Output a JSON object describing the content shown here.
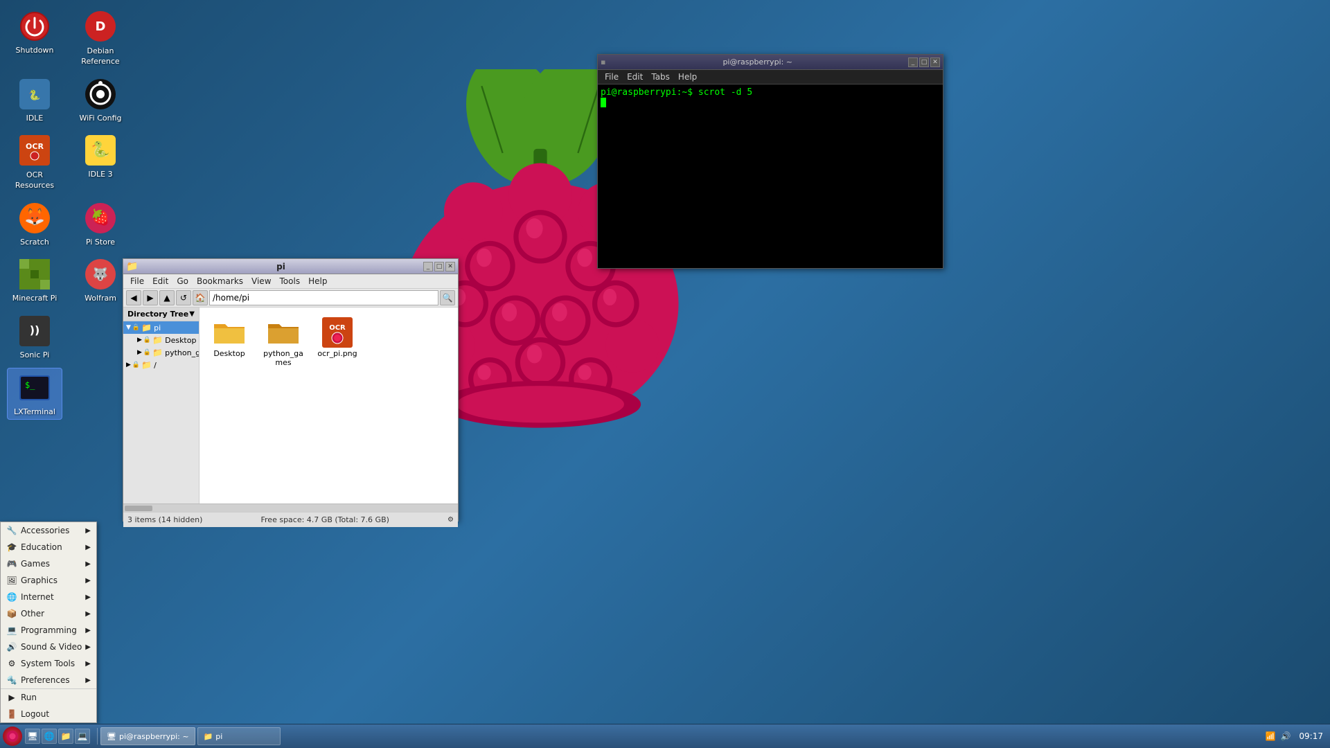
{
  "desktop": {
    "background_color": "#2c5f8a",
    "icons": [
      {
        "id": "shutdown",
        "label": "Shutdown",
        "icon": "⏻",
        "color": "#cc2222"
      },
      {
        "id": "debian-ref",
        "label": "Debian\nReference",
        "icon": "🔴",
        "color": "#cc2222"
      },
      {
        "id": "idle",
        "label": "IDLE",
        "icon": "🐍",
        "color": "#3776ab"
      },
      {
        "id": "wifi-config",
        "label": "WiFi Config",
        "icon": "🎯",
        "color": "#222"
      },
      {
        "id": "ocr-resources",
        "label": "OCR\nResources",
        "icon": "⊕",
        "color": "#cc4411"
      },
      {
        "id": "idle3",
        "label": "IDLE 3",
        "icon": "🐍",
        "color": "#3776ab"
      },
      {
        "id": "scratch",
        "label": "Scratch",
        "icon": "🦊",
        "color": "#ff6600"
      },
      {
        "id": "pistore",
        "label": "Pi Store",
        "icon": "🍓",
        "color": "#cc2255"
      },
      {
        "id": "minecraft",
        "label": "Minecraft Pi",
        "icon": "⛏",
        "color": "#5a3e1b"
      },
      {
        "id": "wolfram",
        "label": "Wolfram",
        "icon": "🐺",
        "color": "#c0392b"
      },
      {
        "id": "sonicpi",
        "label": "Sonic Pi",
        "icon": "))))",
        "color": "#333"
      },
      {
        "id": "lxterminal",
        "label": "LXTerminal",
        "icon": "🖥",
        "color": "#2255aa",
        "selected": true
      }
    ]
  },
  "terminal": {
    "title": "pi@raspberrypi: ~",
    "menu": [
      "File",
      "Edit",
      "Tabs",
      "Help"
    ],
    "prompt": "pi@raspberrypi:~$ scrot -d 5",
    "cursor_line": ""
  },
  "filemanager": {
    "title": "pi",
    "menu": [
      "File",
      "Edit",
      "Go",
      "Bookmarks",
      "View",
      "Tools",
      "Help"
    ],
    "address": "/home/pi",
    "directory_tree_label": "Directory Tree",
    "tree": [
      {
        "id": "pi",
        "label": "pi",
        "level": 0,
        "selected": true,
        "expanded": true
      },
      {
        "id": "desktop",
        "label": "Desktop",
        "level": 1
      },
      {
        "id": "python_games",
        "label": "python_games",
        "level": 1
      },
      {
        "id": "root",
        "label": "/",
        "level": 0
      }
    ],
    "files": [
      {
        "id": "desktop-folder",
        "label": "Desktop",
        "type": "folder"
      },
      {
        "id": "python_games-folder",
        "label": "python_games",
        "type": "folder"
      },
      {
        "id": "ocr-pi-png",
        "label": "ocr_pi.png",
        "type": "image"
      }
    ],
    "status_left": "3 items (14 hidden)",
    "status_right": "Free space: 4.7 GB (Total: 7.6 GB)"
  },
  "appmenu": {
    "items": [
      {
        "id": "accessories",
        "label": "Accessories",
        "has_submenu": true,
        "icon": "🔧"
      },
      {
        "id": "education",
        "label": "Education",
        "has_submenu": true,
        "icon": "🎓"
      },
      {
        "id": "games",
        "label": "Games",
        "has_submenu": true,
        "icon": "🎮"
      },
      {
        "id": "graphics",
        "label": "Graphics",
        "has_submenu": true,
        "icon": "🖼"
      },
      {
        "id": "internet",
        "label": "Internet",
        "has_submenu": true,
        "icon": "🌐"
      },
      {
        "id": "other",
        "label": "Other",
        "has_submenu": true,
        "icon": "📦"
      },
      {
        "id": "programming",
        "label": "Programming",
        "has_submenu": true,
        "icon": "💻"
      },
      {
        "id": "sound-video",
        "label": "Sound & Video",
        "has_submenu": true,
        "icon": "🔊"
      },
      {
        "id": "system-tools",
        "label": "System Tools",
        "has_submenu": true,
        "icon": "⚙"
      },
      {
        "id": "preferences",
        "label": "Preferences",
        "has_submenu": true,
        "icon": "🔩"
      },
      {
        "id": "run",
        "label": "Run",
        "has_submenu": false,
        "icon": "▶"
      },
      {
        "id": "logout",
        "label": "Logout",
        "has_submenu": false,
        "icon": "🚪"
      }
    ]
  },
  "taskbar": {
    "windows": [
      {
        "id": "terminal-task",
        "label": "pi@raspberrypi: ~",
        "icon": "🖥"
      },
      {
        "id": "pi-task",
        "label": "pi",
        "icon": "📁"
      }
    ],
    "time": "09:17"
  }
}
